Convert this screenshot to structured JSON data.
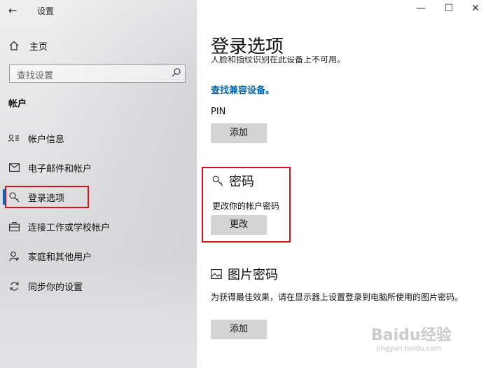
{
  "window": {
    "title": "设置"
  },
  "sidebar": {
    "home_label": "主页",
    "search_placeholder": "查找设置",
    "section_title": "帐户",
    "items": [
      {
        "label": "帐户信息",
        "icon": "person-card-icon"
      },
      {
        "label": "电子邮件和帐户",
        "icon": "mail-icon"
      },
      {
        "label": "登录选项",
        "icon": "key-icon",
        "selected": true
      },
      {
        "label": "连接工作或学校帐户",
        "icon": "briefcase-icon"
      },
      {
        "label": "家庭和其他用户",
        "icon": "person-add-icon"
      },
      {
        "label": "同步你的设置",
        "icon": "sync-icon"
      }
    ]
  },
  "main": {
    "page_title": "登录选项",
    "cut_text": "人脸和指纹识别在此设备上不可用。",
    "compat_link": "查找兼容设备。",
    "pin": {
      "label": "PIN",
      "button": "添加"
    },
    "password": {
      "title": "密码",
      "desc": "更改你的帐户密码",
      "button": "更改"
    },
    "picture_password": {
      "title": "图片密码",
      "desc": "为获得最佳效果，请在显示器上设置登录到电脑所使用的图片密码。",
      "button": "添加"
    }
  },
  "watermark": {
    "brand": "Baidu经验",
    "url": "jingyan.baidu.com"
  },
  "colors": {
    "accent": "#0067b8",
    "link": "#0066b4",
    "highlight_box": "#d9111a"
  }
}
